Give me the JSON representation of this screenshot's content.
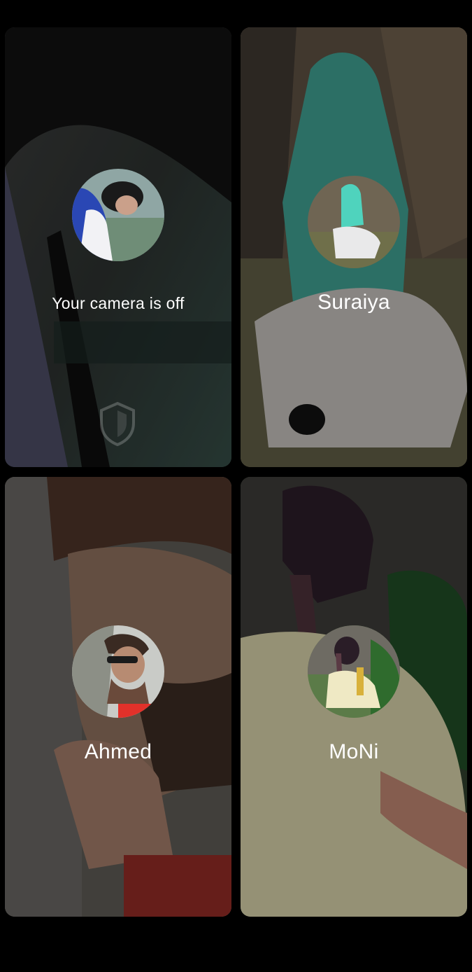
{
  "tiles": [
    {
      "id": "self",
      "label": "Your camera is off",
      "camera_off": true
    },
    {
      "id": "suraiya",
      "label": "Suraiya"
    },
    {
      "id": "ahmed",
      "label": "Ahmed"
    },
    {
      "id": "moni",
      "label": "MoNi"
    }
  ]
}
